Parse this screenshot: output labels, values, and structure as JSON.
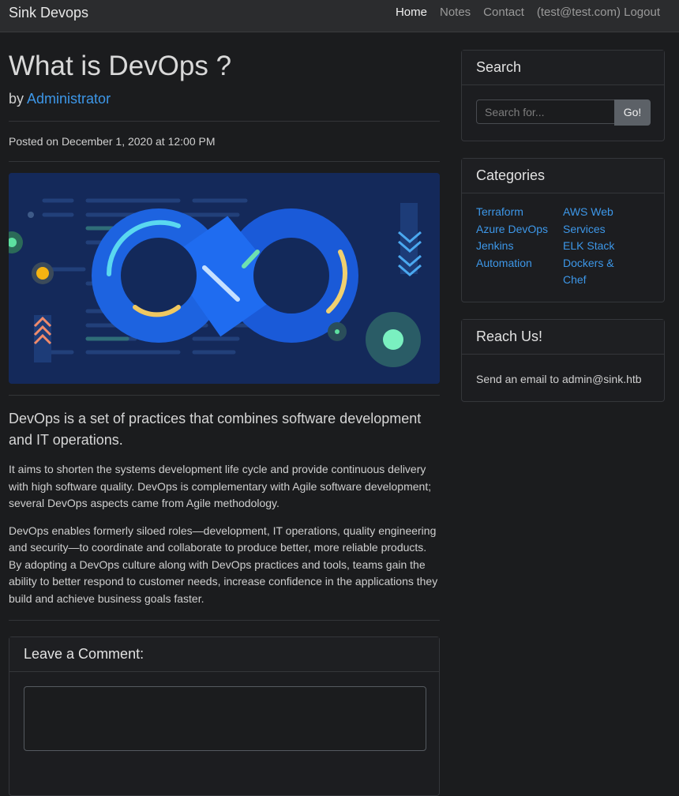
{
  "nav": {
    "brand": "Sink Devops",
    "links": [
      "Home",
      "Notes",
      "Contact",
      "(test@test.com) Logout"
    ]
  },
  "post": {
    "title": "What is DevOps ?",
    "by_prefix": "by",
    "author": "Administrator",
    "posted": "Posted on December 1, 2020 at 12:00 PM",
    "lead": "DevOps is a set of practices that combines software development and IT operations.",
    "paragraphs": [
      "It aims to shorten the systems development life cycle and provide continuous delivery with high software quality. DevOps is complementary with Agile software development; several DevOps aspects came from Agile methodology.",
      "DevOps enables formerly siloed roles—development, IT operations, quality engineering and security—to coordinate and collaborate to produce better, more reliable products. By adopting a DevOps culture along with DevOps practices and tools, teams gain the ability to better respond to customer needs, increase confidence in the applications they build and achieve business goals faster."
    ],
    "comment_heading": "Leave a Comment:"
  },
  "sidebar": {
    "search": {
      "heading": "Search",
      "placeholder": "Search for...",
      "button": "Go!"
    },
    "categories": {
      "heading": "Categories",
      "left": [
        "Terraform",
        "Azure DevOps",
        "Jenkins",
        "Automation"
      ],
      "right": [
        "AWS Web",
        "Services",
        "ELK Stack",
        "Dockers &",
        "Chef"
      ]
    },
    "reach": {
      "heading": "Reach Us!",
      "text": "Send an email to admin@sink.htb"
    }
  },
  "colors": {
    "accent": "#3d97e8",
    "background": "#1b1c1e",
    "navbar": "#2b2c2e"
  }
}
